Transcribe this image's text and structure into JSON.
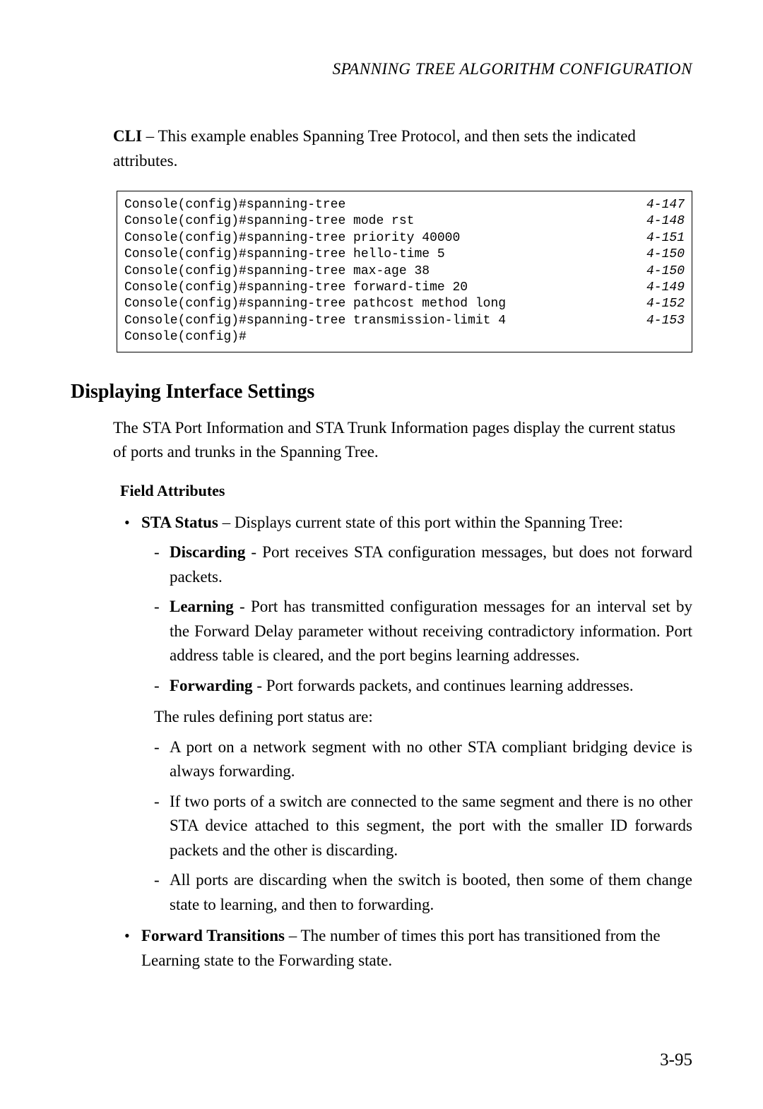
{
  "header": "SPANNING TREE ALGORITHM CONFIGURATION",
  "intro": {
    "cli": "CLI",
    "text": " – This example enables Spanning Tree Protocol, and then sets the indicated attributes."
  },
  "code": [
    {
      "cmd": "Console(config)#spanning-tree",
      "ref": "4-147"
    },
    {
      "cmd": "Console(config)#spanning-tree mode rst",
      "ref": "4-148"
    },
    {
      "cmd": "Console(config)#spanning-tree priority 40000",
      "ref": "4-151"
    },
    {
      "cmd": "Console(config)#spanning-tree hello-time 5",
      "ref": "4-150"
    },
    {
      "cmd": "Console(config)#spanning-tree max-age 38",
      "ref": "4-150"
    },
    {
      "cmd": "Console(config)#spanning-tree forward-time 20",
      "ref": "4-149"
    },
    {
      "cmd": "Console(config)#spanning-tree pathcost method long",
      "ref": "4-152"
    },
    {
      "cmd": "Console(config)#spanning-tree transmission-limit 4",
      "ref": "4-153"
    },
    {
      "cmd": "Console(config)#",
      "ref": ""
    }
  ],
  "section": {
    "title": "Displaying Interface Settings",
    "desc": "The STA Port Information and STA Trunk Information pages display the current status of ports and trunks in the Spanning Tree.",
    "field_head": "Field Attributes"
  },
  "sta_status": {
    "term": "STA Status",
    "desc": " – Displays current state of this port within the Spanning Tree:",
    "states": [
      {
        "term": "Discarding",
        "desc": " - Port receives STA configuration messages, but does not forward packets."
      },
      {
        "term": "Learning",
        "desc": " - Port has transmitted configuration messages for an interval set by the Forward Delay parameter without receiving contradictory information. Port address table is cleared, and the port begins learning addresses."
      },
      {
        "term": "Forwarding",
        "desc": " - Port forwards packets, and continues learning addresses."
      }
    ],
    "rules_intro": "The rules defining port status are:",
    "rules": [
      "A port on a network segment with no other STA compliant bridging device is always forwarding.",
      "If two ports of a switch are connected to the same segment and there is no other STA device attached to this segment, the port with the smaller ID forwards packets and the other is discarding.",
      "All ports are discarding when the switch is booted, then some of them change state to learning, and then to forwarding."
    ]
  },
  "forward_transitions": {
    "term": "Forward Transitions",
    "desc": " – The number of times this port has transitioned from the Learning state to the Forwarding state."
  },
  "page_num": "3-95"
}
